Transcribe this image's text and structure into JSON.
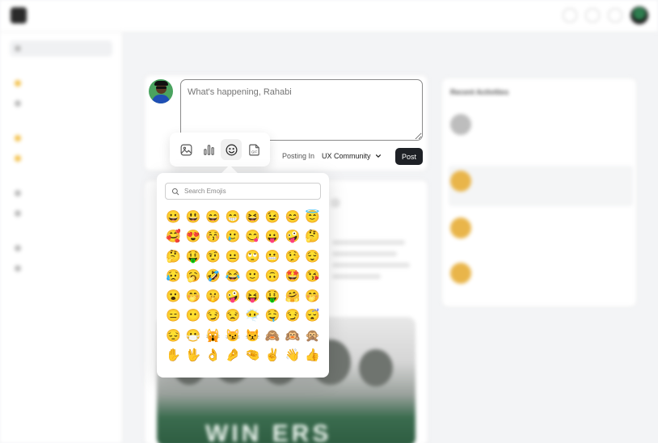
{
  "topbar": {
    "logo_text": "",
    "nav": [
      "",
      "",
      "",
      "",
      ""
    ]
  },
  "feed": {
    "title": ""
  },
  "composer": {
    "placeholder": "What's happening, Rahabi",
    "tools": [
      {
        "name": "image-icon"
      },
      {
        "name": "poll-chart-icon"
      },
      {
        "name": "emoji-smile-icon",
        "active": true
      },
      {
        "name": "gif-icon"
      }
    ],
    "posting_in_label": "Posting In",
    "community": "UX Community",
    "post_label": "Post"
  },
  "emoji_picker": {
    "search_placeholder": "Search Emojis",
    "emojis": [
      "😀",
      "😃",
      "😄",
      "😁",
      "😆",
      "😉",
      "😊",
      "😇",
      "🥰",
      "😍",
      "😚",
      "🥲",
      "😋",
      "😛",
      "🤪",
      "🤔",
      "🤔",
      "🤑",
      "🤨",
      "😐",
      "🙄",
      "😬",
      "🤥",
      "😌",
      "😥",
      "🥱",
      "🤣",
      "😂",
      "🙂",
      "🙃",
      "🤩",
      "😘",
      "😮",
      "🤭",
      "🤫",
      "🤪",
      "😝",
      "🤑",
      "🤗",
      "🤭",
      "😑",
      "😶",
      "😏",
      "😒",
      "😶‍🌫️",
      "🤤",
      "😏",
      "😴",
      "😔",
      "😷",
      "🙀",
      "😼",
      "😾",
      "🙈",
      "🙉",
      "🙊",
      "✋",
      "🖖",
      "👌",
      "🤌",
      "🤏",
      "✌️",
      "👋",
      "👍"
    ]
  },
  "activities": {
    "title": "Recent Activities"
  },
  "accent_color": "#1e2126"
}
